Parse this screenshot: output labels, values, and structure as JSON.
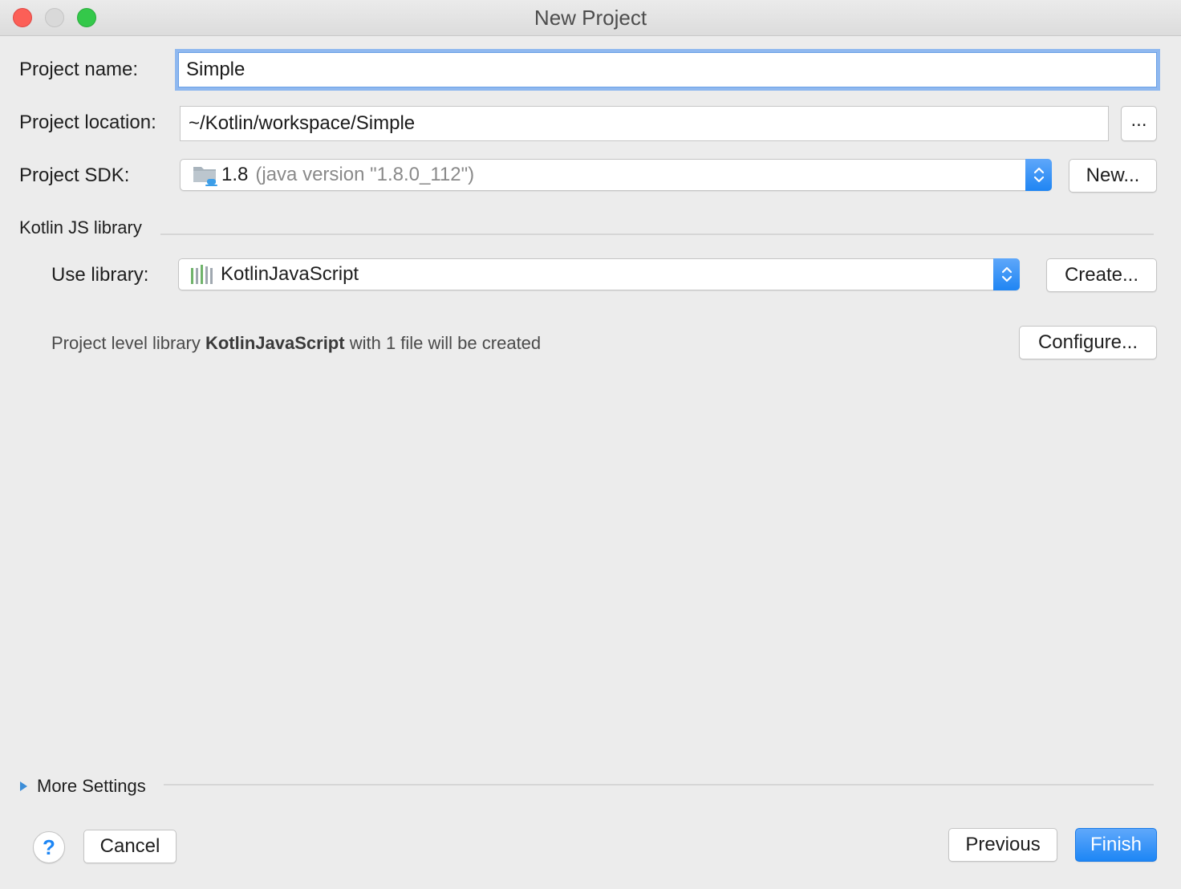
{
  "window": {
    "title": "New Project"
  },
  "form": {
    "project_name_label": "Project name:",
    "project_name_value": "Simple",
    "project_location_label": "Project location:",
    "project_location_value": "~/Kotlin/workspace/Simple",
    "browse_label": "...",
    "project_sdk_label": "Project SDK:",
    "sdk_version": "1.8",
    "sdk_detail": "(java version \"1.8.0_112\")",
    "sdk_icon": "folder-java-icon",
    "new_sdk_label": "New..."
  },
  "kotlin_js": {
    "section_title": "Kotlin JS library",
    "use_library_label": "Use library:",
    "library_value": "KotlinJavaScript",
    "library_icon": "library-icon",
    "create_label": "Create...",
    "info_prefix": "Project level library",
    "info_library": "KotlinJavaScript",
    "info_suffix": "with 1 file will be created",
    "configure_label": "Configure..."
  },
  "more_settings": {
    "label": "More Settings",
    "expanded": false
  },
  "footer": {
    "help_label": "?",
    "cancel_label": "Cancel",
    "previous_label": "Previous",
    "finish_label": "Finish"
  },
  "colors": {
    "accent": "#1d86f5",
    "background": "#ececec",
    "focus_ring": "#8fb8ef"
  }
}
